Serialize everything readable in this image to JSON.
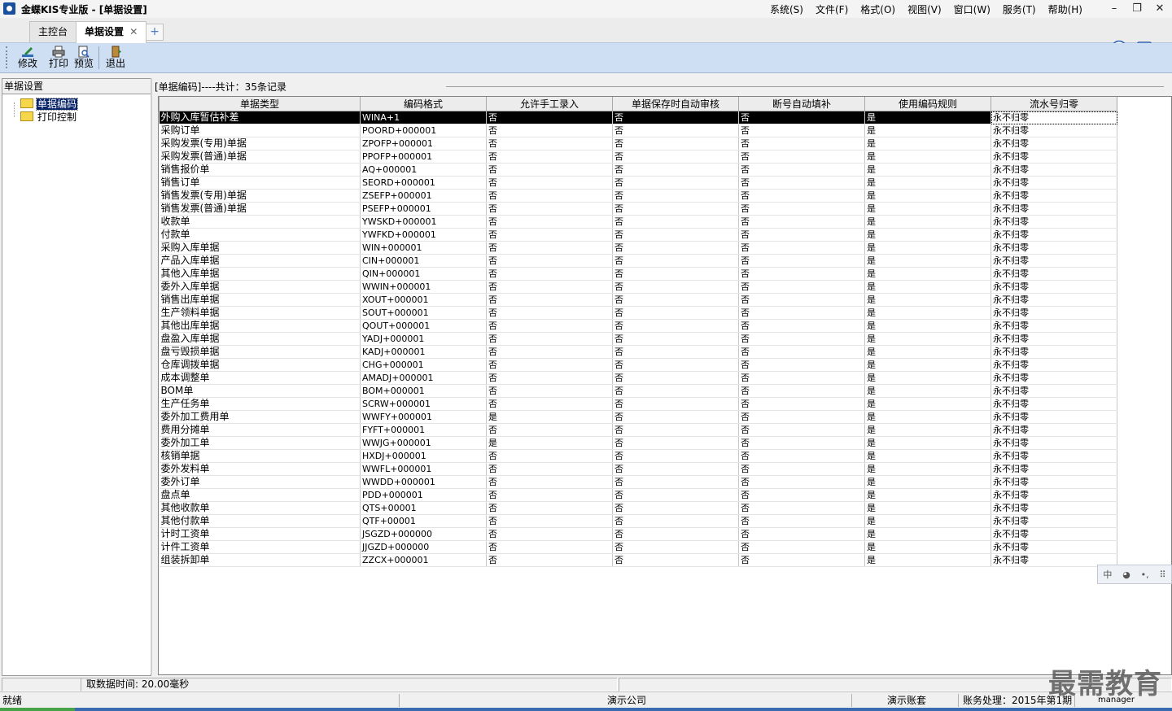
{
  "window": {
    "title": "金蝶KIS专业版 - [单据设置]",
    "menu": [
      "系统(S)",
      "文件(F)",
      "格式(O)",
      "视图(V)",
      "窗口(W)",
      "服务(T)",
      "帮助(H)"
    ],
    "controls": {
      "minimize": "–",
      "restore": "❐",
      "close": "✕"
    }
  },
  "tabs": [
    {
      "label": "主控台",
      "active": false
    },
    {
      "label": "单据设置",
      "active": true,
      "close": "✕"
    }
  ],
  "tab_add": "+",
  "toolbar": {
    "edit": "修改",
    "print": "打印",
    "preview": "预览",
    "exit": "退出"
  },
  "left_panel": {
    "title": "单据设置",
    "tree": [
      {
        "label": "单据编码",
        "selected": true
      },
      {
        "label": "打印控制",
        "selected": false
      }
    ]
  },
  "grid": {
    "caption": "[单据编码]----共计：35条记录",
    "headers": [
      "单据类型",
      "编码格式",
      "允许手工录入",
      "单据保存时自动审核",
      "断号自动填补",
      "使用编码规则",
      "流水号归零"
    ],
    "rows": [
      [
        "外购入库暂估补差",
        "WINA+1",
        "否",
        "否",
        "否",
        "是",
        "永不归零"
      ],
      [
        "采购订单",
        "POORD+000001",
        "否",
        "否",
        "否",
        "是",
        "永不归零"
      ],
      [
        "采购发票(专用)单据",
        "ZPOFP+000001",
        "否",
        "否",
        "否",
        "是",
        "永不归零"
      ],
      [
        "采购发票(普通)单据",
        "PPOFP+000001",
        "否",
        "否",
        "否",
        "是",
        "永不归零"
      ],
      [
        "销售报价单",
        "AQ+000001",
        "否",
        "否",
        "否",
        "是",
        "永不归零"
      ],
      [
        "销售订单",
        "SEORD+000001",
        "否",
        "否",
        "否",
        "是",
        "永不归零"
      ],
      [
        "销售发票(专用)单据",
        "ZSEFP+000001",
        "否",
        "否",
        "否",
        "是",
        "永不归零"
      ],
      [
        "销售发票(普通)单据",
        "PSEFP+000001",
        "否",
        "否",
        "否",
        "是",
        "永不归零"
      ],
      [
        "收款单",
        "YWSKD+000001",
        "否",
        "否",
        "否",
        "是",
        "永不归零"
      ],
      [
        "付款单",
        "YWFKD+000001",
        "否",
        "否",
        "否",
        "是",
        "永不归零"
      ],
      [
        "采购入库单据",
        "WIN+000001",
        "否",
        "否",
        "否",
        "是",
        "永不归零"
      ],
      [
        "产品入库单据",
        "CIN+000001",
        "否",
        "否",
        "否",
        "是",
        "永不归零"
      ],
      [
        "其他入库单据",
        "QIN+000001",
        "否",
        "否",
        "否",
        "是",
        "永不归零"
      ],
      [
        "委外入库单据",
        "WWIN+000001",
        "否",
        "否",
        "否",
        "是",
        "永不归零"
      ],
      [
        "销售出库单据",
        "XOUT+000001",
        "否",
        "否",
        "否",
        "是",
        "永不归零"
      ],
      [
        "生产领料单据",
        "SOUT+000001",
        "否",
        "否",
        "否",
        "是",
        "永不归零"
      ],
      [
        "其他出库单据",
        "QOUT+000001",
        "否",
        "否",
        "否",
        "是",
        "永不归零"
      ],
      [
        "盘盈入库单据",
        "YADJ+000001",
        "否",
        "否",
        "否",
        "是",
        "永不归零"
      ],
      [
        "盘亏毁损单据",
        "KADJ+000001",
        "否",
        "否",
        "否",
        "是",
        "永不归零"
      ],
      [
        "仓库调拨单据",
        "CHG+000001",
        "否",
        "否",
        "否",
        "是",
        "永不归零"
      ],
      [
        "成本调整单",
        "AMADJ+000001",
        "否",
        "否",
        "否",
        "是",
        "永不归零"
      ],
      [
        "BOM单",
        "BOM+000001",
        "否",
        "否",
        "否",
        "是",
        "永不归零"
      ],
      [
        "生产任务单",
        "SCRW+000001",
        "否",
        "否",
        "否",
        "是",
        "永不归零"
      ],
      [
        "委外加工费用单",
        "WWFY+000001",
        "是",
        "否",
        "否",
        "是",
        "永不归零"
      ],
      [
        "费用分摊单",
        "FYFT+000001",
        "否",
        "否",
        "否",
        "是",
        "永不归零"
      ],
      [
        "委外加工单",
        "WWJG+000001",
        "是",
        "否",
        "否",
        "是",
        "永不归零"
      ],
      [
        "核销单据",
        "HXDJ+000001",
        "否",
        "否",
        "否",
        "是",
        "永不归零"
      ],
      [
        "委外发料单",
        "WWFL+000001",
        "否",
        "否",
        "否",
        "是",
        "永不归零"
      ],
      [
        "委外订单",
        "WWDD+000001",
        "否",
        "否",
        "否",
        "是",
        "永不归零"
      ],
      [
        "盘点单",
        "PDD+000001",
        "否",
        "否",
        "否",
        "是",
        "永不归零"
      ],
      [
        "其他收款单",
        "QTS+00001",
        "否",
        "否",
        "否",
        "是",
        "永不归零"
      ],
      [
        "其他付款单",
        "QTF+00001",
        "否",
        "否",
        "否",
        "是",
        "永不归零"
      ],
      [
        "计时工资单",
        "JSGZD+000000",
        "否",
        "否",
        "否",
        "是",
        "永不归零"
      ],
      [
        "计件工资单",
        "JJGZD+000000",
        "否",
        "否",
        "否",
        "是",
        "永不归零"
      ],
      [
        "组装拆卸单",
        "ZZCX+000001",
        "否",
        "否",
        "否",
        "是",
        "永不归零"
      ]
    ]
  },
  "info_bar": {
    "load_time": "取数据时间: 20.00毫秒"
  },
  "ime_bar": [
    "中",
    "◕",
    "•,",
    "⠿"
  ],
  "status_bar": {
    "state": "就绪",
    "company": "演示公司",
    "account": "演示账套",
    "period": "账务处理：2015年第1期",
    "user": "manager"
  },
  "watermark": "最需教育",
  "colors": {
    "toolbar_bg": "#cfdff3",
    "selected_row": "#000000",
    "tree_selected": "#0a246a"
  }
}
